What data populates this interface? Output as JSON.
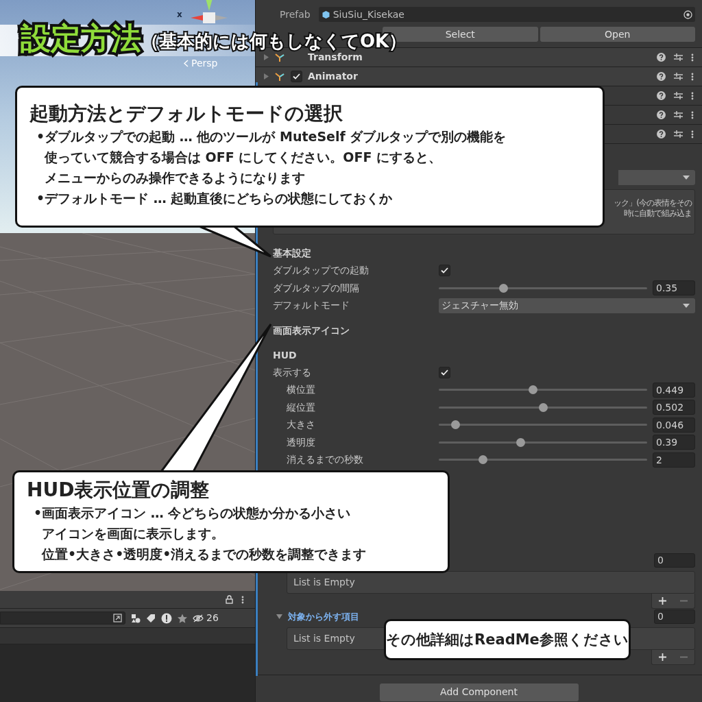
{
  "banner": {
    "title": "設定方法",
    "subtitle": "（基本的には何もしなくてOK）"
  },
  "scene": {
    "axis_label": "x",
    "view_label": "Persp"
  },
  "hierarchy": {
    "count": "26"
  },
  "inspector": {
    "prefab_label": "Prefab",
    "prefab_value": "SiuSiu_Kisekae",
    "buttons": [
      "Select",
      "Open"
    ],
    "components": [
      {
        "kind": "plain",
        "name": "Transform"
      },
      {
        "kind": "toggle",
        "name": "Animator",
        "checked": true
      }
    ],
    "help_lines": [
      "ック」(今の表情をその",
      "時に自動で組み込ま"
    ],
    "sections": [
      {
        "title": "基本設定",
        "rows": [
          {
            "kind": "checkbox",
            "label": "ダブルタップでの起動",
            "checked": true
          },
          {
            "kind": "slider",
            "label": "ダブルタップの間隔",
            "level": 0.31,
            "value": "0.35"
          },
          {
            "kind": "dropdown",
            "label": "デフォルトモード",
            "value": "ジェスチャー無効"
          }
        ]
      },
      {
        "title": "画面表示アイコン"
      },
      {
        "title": "HUD",
        "rows": [
          {
            "kind": "checkbox",
            "label": "表示する",
            "checked": true,
            "children": [
              {
                "kind": "slider",
                "label": "横位置",
                "level": 0.45,
                "value": "0.449"
              },
              {
                "kind": "slider",
                "label": "縦位置",
                "level": 0.5,
                "value": "0.502"
              },
              {
                "kind": "slider",
                "label": "大きさ",
                "level": 0.08,
                "value": "0.046"
              },
              {
                "kind": "slider",
                "label": "透明度",
                "level": 0.39,
                "value": "0.39"
              },
              {
                "kind": "slider",
                "label": "消えるまでの秒数",
                "level": 0.21,
                "value": "2"
              }
            ]
          }
        ]
      }
    ],
    "lists": [
      {
        "count": "0",
        "empty_text": "List is Empty"
      },
      {
        "title": "対象から外す項目",
        "expanded": true,
        "count": "0",
        "empty_text": "List is Empty"
      }
    ],
    "add_button": "Add Component"
  },
  "callouts": [
    {
      "title": "起動方法とデフォルトモードの選択",
      "bullets": [
        {
          "lines": [
            "•ダブルタップでの起動 … 他のツールが MuteSelf ダブルタップで別の機能を",
            "使っていて競合する場合は OFF にしてください。OFF にすると、",
            "メニューからのみ操作できるようになります"
          ]
        },
        {
          "lines": [
            "•デフォルトモード … 起動直後にどちらの状態にしておくか"
          ]
        }
      ]
    },
    {
      "title": "HUD表示位置の調整",
      "bullets": [
        {
          "lines": [
            "•画面表示アイコン … 今どちらの状態か分かる小さい",
            "アイコンを画面に表示します。",
            "位置•大きさ•透明度•消えるまでの秒数を調整できます"
          ]
        }
      ]
    },
    {
      "title": "その他詳細はReadMe参照ください"
    }
  ]
}
